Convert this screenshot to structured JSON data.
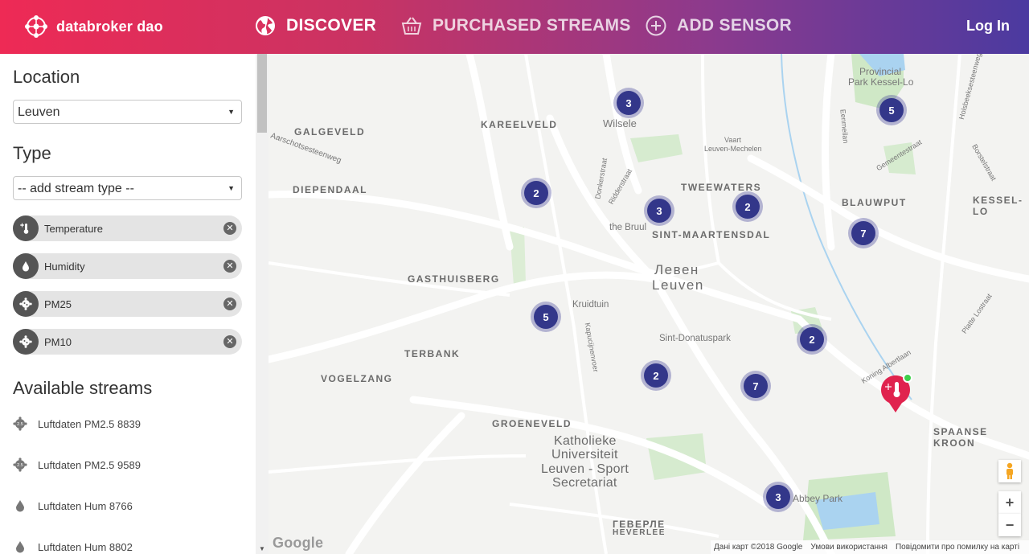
{
  "brand": {
    "name": "databroker dao"
  },
  "nav": {
    "discover": "DISCOVER",
    "purchased": "PURCHASED STREAMS",
    "add_sensor": "ADD SENSOR",
    "login": "Log In"
  },
  "sidebar": {
    "location_title": "Location",
    "location_value": "Leuven",
    "type_title": "Type",
    "type_placeholder": "-- add stream type --",
    "chips": [
      {
        "label": "Temperature",
        "icon": "thermometer-icon"
      },
      {
        "label": "Humidity",
        "icon": "droplet-icon"
      },
      {
        "label": "PM25",
        "icon": "particle-icon"
      },
      {
        "label": "PM10",
        "icon": "particle-icon"
      }
    ],
    "available_title": "Available streams",
    "streams": [
      {
        "label": "Luftdaten PM2.5 8839",
        "icon": "pm25-icon"
      },
      {
        "label": "Luftdaten PM2.5 9589",
        "icon": "pm25-icon"
      },
      {
        "label": "Luftdaten Hum 8766",
        "icon": "droplet-icon"
      },
      {
        "label": "Luftdaten Hum 8802",
        "icon": "droplet-icon"
      }
    ]
  },
  "map": {
    "areas": [
      "GALGEVELD",
      "KAREELVELD",
      "DIEPENDAAL",
      "TWEEWATERS",
      "BLAUWPUT",
      "KESSEL-LO",
      "SINT-MAARTENSDAL",
      "GASTHUISBERG",
      "TERBANK",
      "VOGELZANG",
      "GROENEVELD",
      "SPAANSE KROON",
      "ГЕВЕРЛЕ",
      "HEVERLEE"
    ],
    "city": [
      "Левен",
      "Leuven"
    ],
    "university": [
      "Katholieke",
      "Universiteit",
      "Leuven - Sport",
      "Secretariat"
    ],
    "places": [
      "Wilsele",
      "Provincial",
      "Park Kessel-Lo",
      "Vaart",
      "Leuven-Mechelen",
      "the Bruul",
      "Kruidtuin",
      "Sint-Donatuspark",
      "Koning Albertlaan",
      "Gemeentestraat",
      "Borstelstraat",
      "Platte Lostraat",
      "Holsbeeksesteenweg",
      "Eenmeilan",
      "Ridderstraat",
      "Donkerstraat",
      "Kapucijnenvoer",
      "Aarschotsesteenweg",
      "Abbey Park"
    ],
    "clusters": [
      3,
      5,
      2,
      3,
      2,
      7,
      5,
      2,
      2,
      7,
      3
    ],
    "attribution": "Дані карт ©2018 Google",
    "terms": "Умови використання",
    "report": "Повідомити про помилку на карті",
    "google_label": "Google",
    "zoom_in": "+",
    "zoom_out": "−"
  },
  "colors": {
    "header_start": "#ee2a55",
    "header_end": "#4b3aa0",
    "cluster": "#33378a",
    "pin": "#e0234e"
  }
}
